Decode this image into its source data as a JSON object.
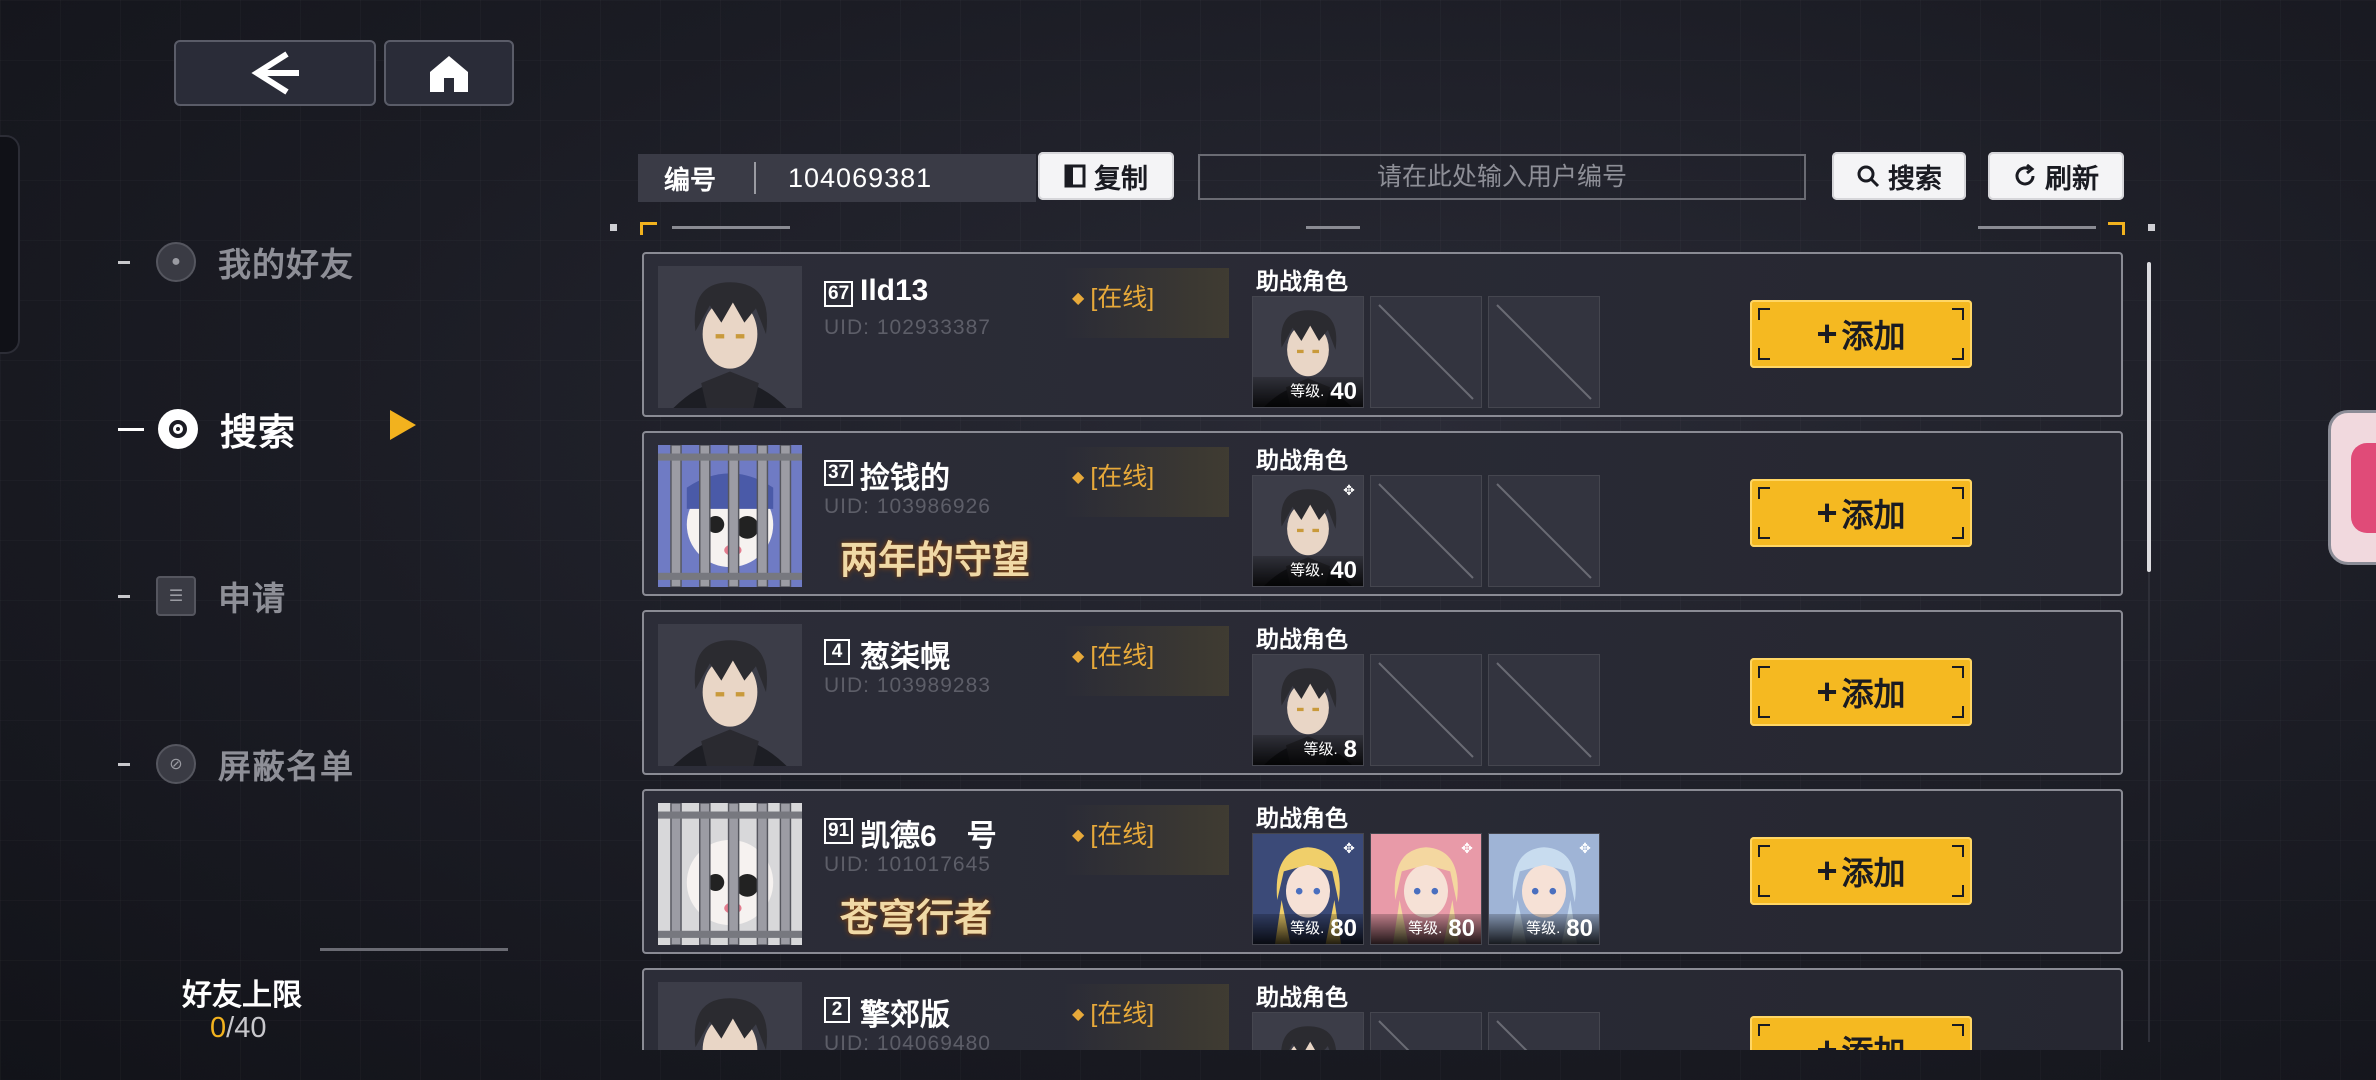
{
  "nav": {
    "items": [
      {
        "label": "我的好友",
        "icon": "friends-icon",
        "active": false
      },
      {
        "label": "搜索",
        "icon": "search-icon",
        "active": true
      },
      {
        "label": "申请",
        "icon": "list-icon",
        "active": false
      },
      {
        "label": "屏蔽名单",
        "icon": "block-icon",
        "active": false
      }
    ]
  },
  "friend_limit": {
    "label": "好友上限",
    "current": "0",
    "separator": "/40"
  },
  "search_bar": {
    "id_label": "编号",
    "id_value": "104069381",
    "copy_label": "复制",
    "placeholder": "请在此处输入用户编号",
    "search_label": "搜索",
    "refresh_label": "刷新"
  },
  "support_label": "助战角色",
  "add_label": "添加",
  "level_text": "等级.",
  "colors": {
    "accent": "#f5b921",
    "online": "#e7a93a",
    "card_border": "#8a8b94"
  },
  "users": [
    {
      "level": "67",
      "name": "Ild13",
      "uid": "UID: 102933387",
      "status": "[在线]",
      "title": "",
      "avatar": "male-portrait",
      "characters": [
        {
          "type": "male",
          "level": "40",
          "mark": false
        },
        {
          "type": "empty"
        },
        {
          "type": "empty"
        }
      ]
    },
    {
      "level": "37",
      "name": "捡钱的",
      "uid": "UID: 103986926",
      "status": "[在线]",
      "title": "两年的守望",
      "avatar": "caged-chibi",
      "characters": [
        {
          "type": "male",
          "level": "40",
          "mark": true
        },
        {
          "type": "empty"
        },
        {
          "type": "empty"
        }
      ]
    },
    {
      "level": "4",
      "name": "葱柒幌",
      "uid": "UID: 103989283",
      "status": "[在线]",
      "title": "",
      "avatar": "male-portrait",
      "characters": [
        {
          "type": "male",
          "level": "8",
          "mark": false
        },
        {
          "type": "empty"
        },
        {
          "type": "empty"
        }
      ]
    },
    {
      "level": "91",
      "name": "凯德6　号",
      "uid": "UID: 101017645",
      "status": "[在线]",
      "title": "苍穹行者",
      "avatar": "caged-chibi-white",
      "characters": [
        {
          "type": "blonde",
          "level": "80",
          "mark": true
        },
        {
          "type": "pink",
          "level": "80",
          "mark": true
        },
        {
          "type": "silver",
          "level": "80",
          "mark": true
        }
      ]
    },
    {
      "level": "2",
      "name": "擎郊版",
      "uid": "UID: 104069480",
      "status": "[在线]",
      "title": "",
      "avatar": "male-portrait",
      "characters": [
        {
          "type": "male",
          "level": "",
          "mark": false
        },
        {
          "type": "empty"
        },
        {
          "type": "empty"
        }
      ]
    }
  ]
}
